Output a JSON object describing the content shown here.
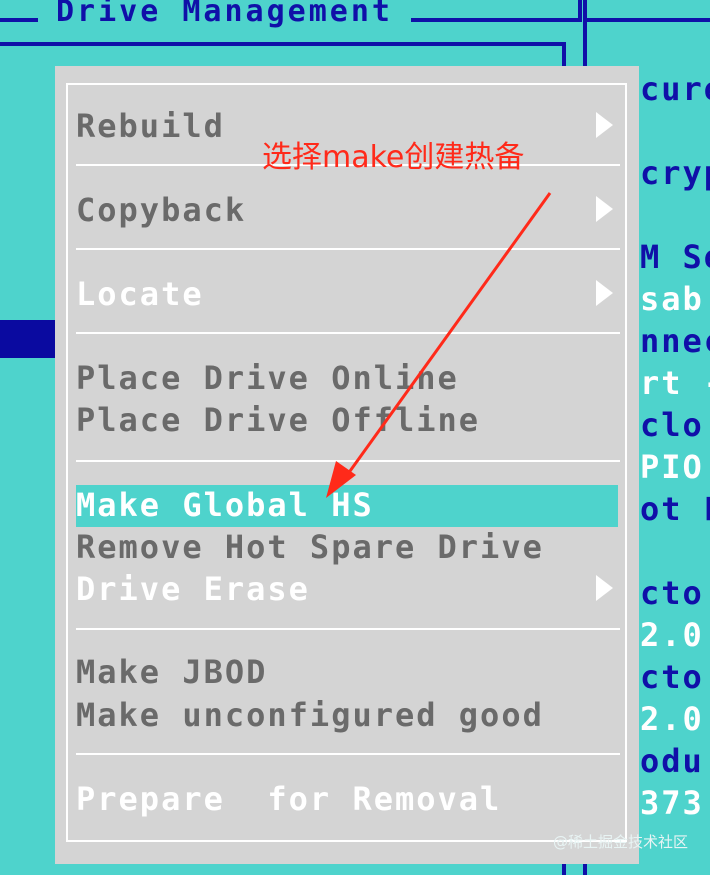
{
  "window": {
    "title": "Drive Management"
  },
  "right_panel": {
    "lines": [
      {
        "text": "cure",
        "white": false
      },
      {
        "text": "",
        "white": false
      },
      {
        "text": "cryp",
        "white": false
      },
      {
        "text": "",
        "white": false
      },
      {
        "text": "M Se",
        "white": false
      },
      {
        "text": "sab",
        "white": true
      },
      {
        "text": "nnec",
        "white": false
      },
      {
        "text": "rt -",
        "white": true
      },
      {
        "text": "clo",
        "white": false
      },
      {
        "text": "PIO",
        "white": true
      },
      {
        "text": "ot F",
        "white": false
      },
      {
        "text": "",
        "white": false
      },
      {
        "text": "cto",
        "white": false
      },
      {
        "text": "2.0",
        "white": true
      },
      {
        "text": "cto",
        "white": false
      },
      {
        "text": "2.0",
        "white": true
      },
      {
        "text": "odu",
        "white": false
      },
      {
        "text": "373",
        "white": true
      }
    ]
  },
  "menu": {
    "items": [
      {
        "label": "Rebuild"
      },
      {
        "label": "Copyback"
      },
      {
        "label": "Locate"
      },
      {
        "label": "Place Drive Online"
      },
      {
        "label": "Place Drive Offline"
      },
      {
        "label": "Make Global HS"
      },
      {
        "label": "Remove Hot Spare Drive"
      },
      {
        "label": "Drive Erase"
      },
      {
        "label": "Make JBOD"
      },
      {
        "label": "Make unconfigured good"
      },
      {
        "label": "Prepare  for Removal"
      }
    ],
    "selected_index": 5
  },
  "annotation": {
    "text": "选择make创建热备",
    "color": "#ff2a1a"
  },
  "watermark": {
    "text": "@稀土掘金技术社区"
  },
  "colors": {
    "background": "#4ed3cc",
    "frame": "#1010a8",
    "menu_bg": "#d4d4d4",
    "menu_text_disabled": "#6a6a6a",
    "menu_text_enabled": "#ffffff"
  }
}
